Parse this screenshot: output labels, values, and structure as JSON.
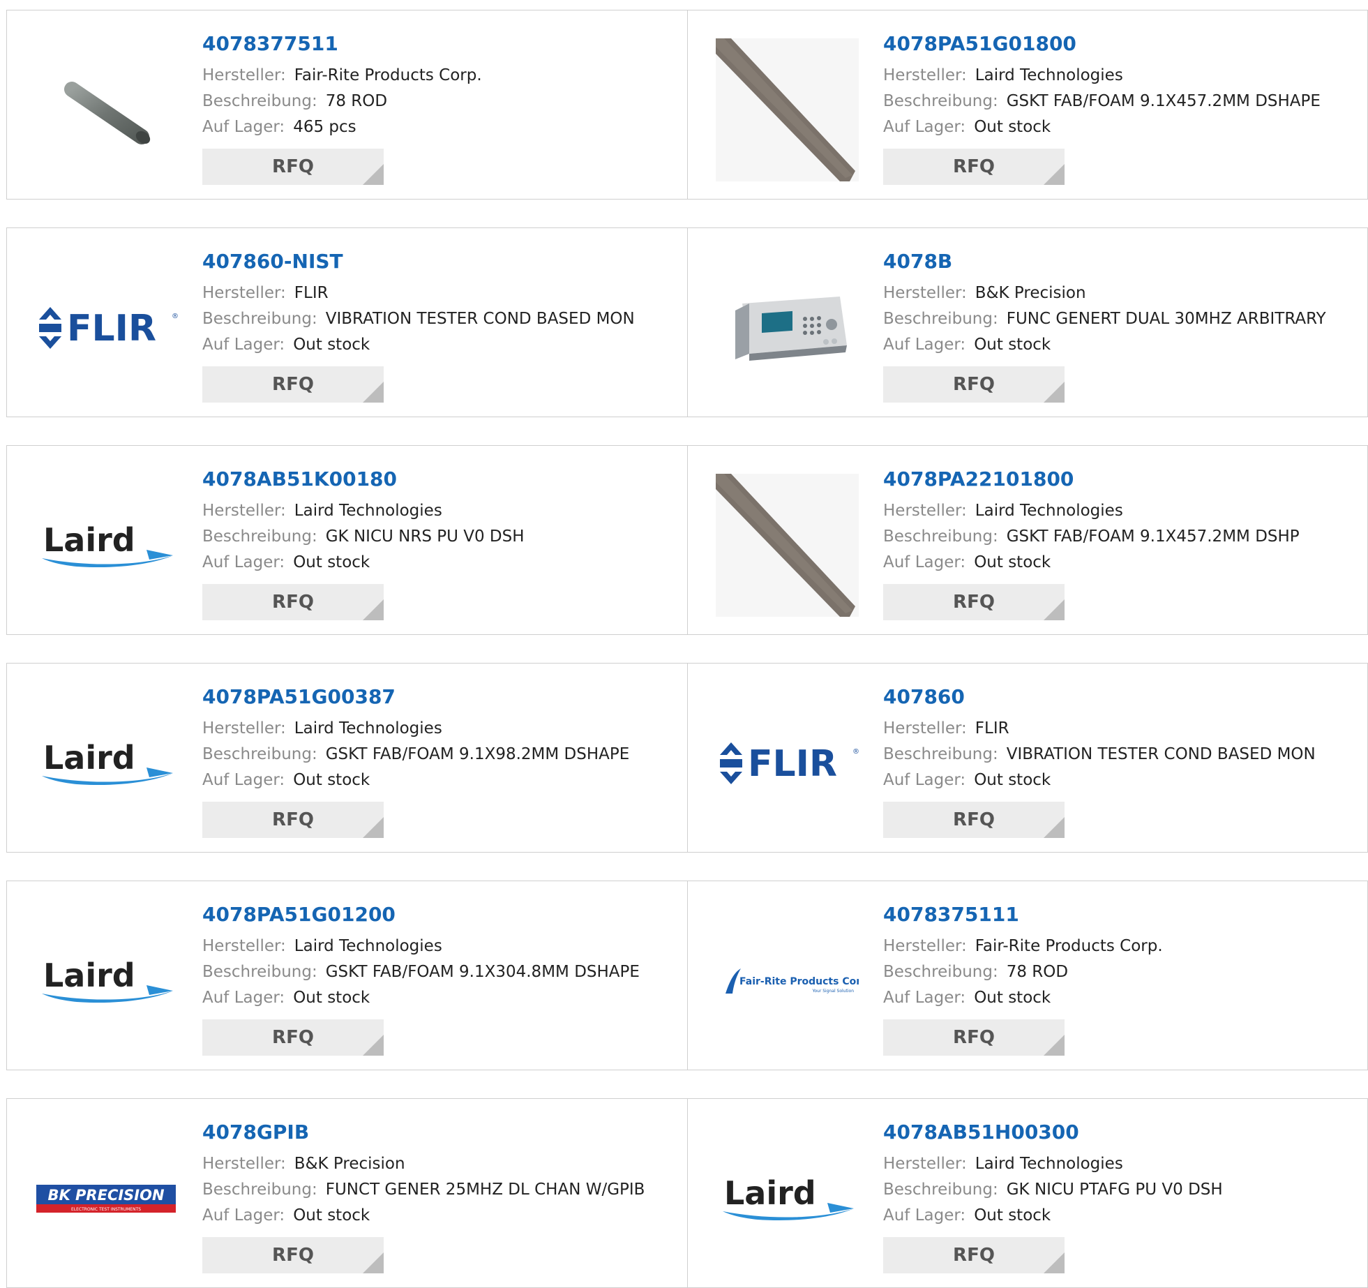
{
  "labels": {
    "manufacturer": "Hersteller:",
    "description": "Beschreibung:",
    "stock": "Auf Lager:",
    "rfq": "RFQ"
  },
  "logos": {
    "flir": "FLIR",
    "laird": "Laird",
    "bk_precision": "BK PRECISION",
    "bk_precision_sub": "ELECTRONIC TEST INSTRUMENTS",
    "fair_rite": "Fair-Rite Products Corp.",
    "fair_rite_sub": "Your Signal Solution"
  },
  "colors": {
    "link": "#1565b3",
    "label": "#8a8a8a",
    "rfq_bg": "#ececec",
    "flir_blue": "#1a4f9c",
    "laird_blue": "#2a8fd6",
    "bk_red": "#d4232a",
    "bk_blue": "#1f4fa3"
  },
  "products": [
    {
      "part": "4078377511",
      "manufacturer": "Fair-Rite Products Corp.",
      "description": "78 ROD",
      "stock": "465 pcs",
      "image": "gray-rod-image"
    },
    {
      "part": "4078PA51G01800",
      "manufacturer": "Laird Technologies",
      "description": "GSKT FAB/FOAM 9.1X457.2MM DSHAPE",
      "stock": "Out stock",
      "image": "gasket-strip-image"
    },
    {
      "part": "407860-NIST",
      "manufacturer": "FLIR",
      "description": "VIBRATION TESTER COND BASED MON",
      "stock": "Out stock",
      "image": "flir-logo"
    },
    {
      "part": "4078B",
      "manufacturer": "B&K Precision",
      "description": "FUNC GENERT DUAL 30MHZ ARBITRARY",
      "stock": "Out stock",
      "image": "function-generator-image"
    },
    {
      "part": "4078AB51K00180",
      "manufacturer": "Laird Technologies",
      "description": "GK NICU NRS PU V0 DSH",
      "stock": "Out stock",
      "image": "laird-logo"
    },
    {
      "part": "4078PA22101800",
      "manufacturer": "Laird Technologies",
      "description": "GSKT FAB/FOAM 9.1X457.2MM DSHP",
      "stock": "Out stock",
      "image": "gasket-strip-image"
    },
    {
      "part": "4078PA51G00387",
      "manufacturer": "Laird Technologies",
      "description": "GSKT FAB/FOAM 9.1X98.2MM DSHAPE",
      "stock": "Out stock",
      "image": "laird-logo"
    },
    {
      "part": "407860",
      "manufacturer": "FLIR",
      "description": "VIBRATION TESTER COND BASED MON",
      "stock": "Out stock",
      "image": "flir-logo"
    },
    {
      "part": "4078PA51G01200",
      "manufacturer": "Laird Technologies",
      "description": "GSKT FAB/FOAM 9.1X304.8MM DSHAPE",
      "stock": "Out stock",
      "image": "laird-logo"
    },
    {
      "part": "4078375111",
      "manufacturer": "Fair-Rite Products Corp.",
      "description": "78 ROD",
      "stock": "Out stock",
      "image": "fair-rite-logo"
    },
    {
      "part": "4078GPIB",
      "manufacturer": "B&K Precision",
      "description": "FUNCT GENER 25MHZ DL CHAN W/GPIB",
      "stock": "Out stock",
      "image": "bk-precision-logo"
    },
    {
      "part": "4078AB51H00300",
      "manufacturer": "Laird Technologies",
      "description": "GK NICU PTAFG PU V0 DSH",
      "stock": "Out stock",
      "image": "laird-logo"
    }
  ]
}
